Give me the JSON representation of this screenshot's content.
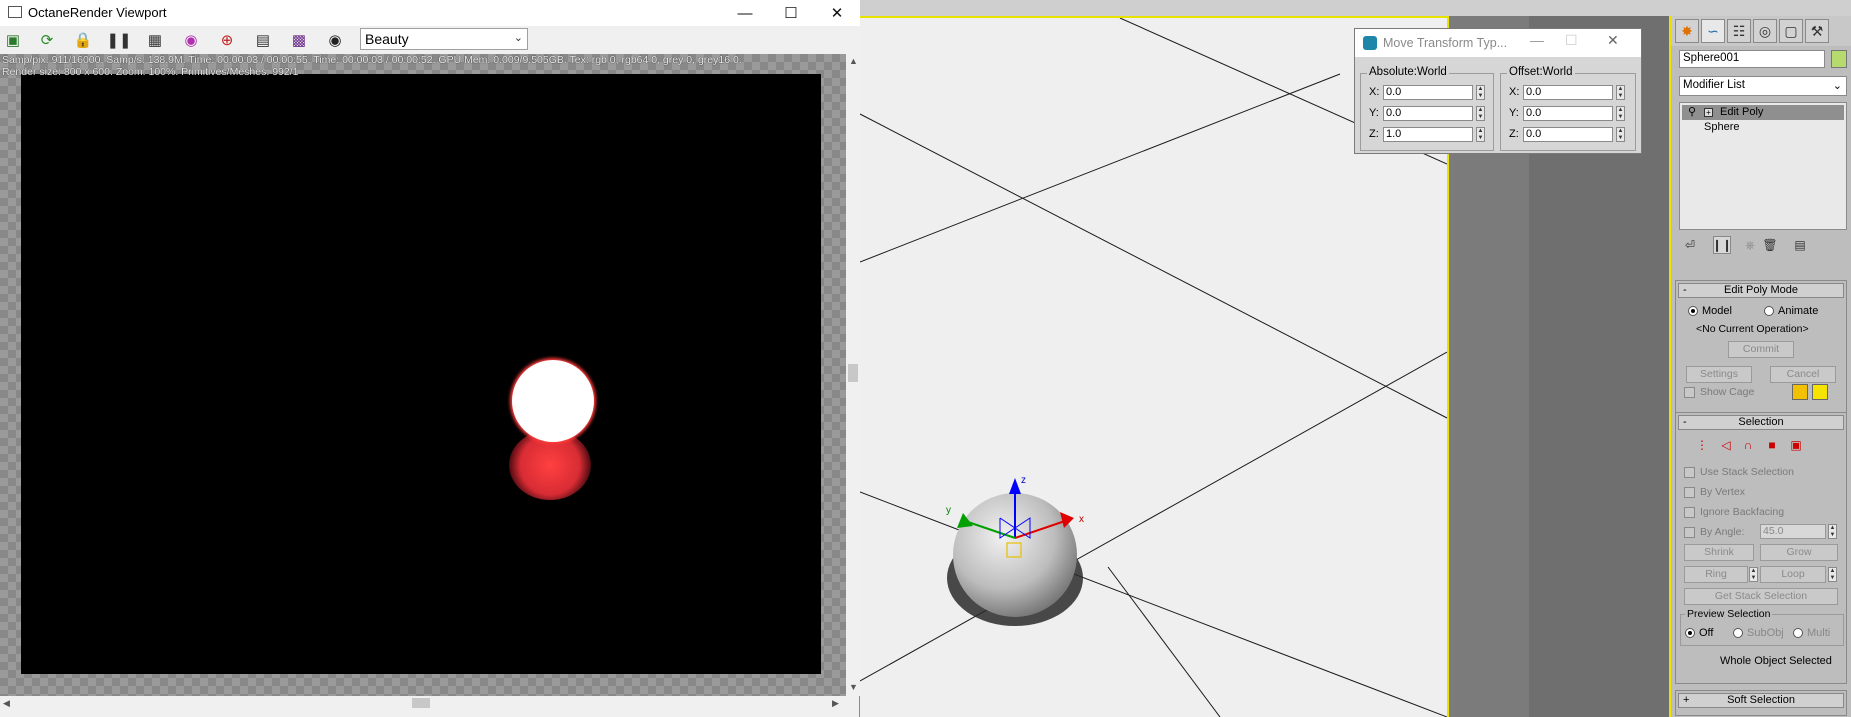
{
  "octane": {
    "title": "OctaneRender Viewport",
    "render_pass": "Beauty",
    "stats_line1": "Samp/pix: 911/16000.   Samp/s: 138.9M.   Time: 00:00:03 / 00:00:55.   Time: 00:00:03 / 00:00:52.   GPU Mem: 0.009/9.505GB.   Tex: rgb 0, rgb64 0, grey 0, grey16 0.",
    "stats_line2": "Render size: 800 x 600.   Zoom: 100%.   Primitives/Meshes: 992/1",
    "toolbar_icons": [
      "save-render-icon",
      "restart-render-icon",
      "lock-icon",
      "pause-icon",
      "region-render-icon",
      "color-picker-icon",
      "focus-picker-icon",
      "settings-icon",
      "film-icon",
      "camera-icon"
    ]
  },
  "move_transform": {
    "title": "Move Transform Typ...",
    "absolute": {
      "label": "Absolute:World",
      "x_label": "X:",
      "y_label": "Y:",
      "z_label": "Z:",
      "x": "0.0",
      "y": "0.0",
      "z": "1.0"
    },
    "offset": {
      "label": "Offset:World",
      "x_label": "X:",
      "y_label": "Y:",
      "z_label": "Z:",
      "x": "0.0",
      "y": "0.0",
      "z": "0.0"
    }
  },
  "viewport": {
    "gizmo": {
      "x_label": "x",
      "y_label": "y",
      "z_label": "z"
    }
  },
  "command_panel": {
    "object_name": "Sphere001",
    "object_color": "#b7da6e",
    "modifier_list": "Modifier List",
    "stack": [
      "Edit Poly",
      "Sphere"
    ],
    "edit_poly_mode": {
      "header": "Edit Poly Mode",
      "model": "Model",
      "animate": "Animate",
      "operation": "<No Current Operation>",
      "commit": "Commit",
      "settings": "Settings",
      "cancel": "Cancel",
      "show_cage": "Show Cage"
    },
    "selection": {
      "header": "Selection",
      "use_stack": "Use Stack Selection",
      "by_vertex": "By Vertex",
      "ignore_backfacing": "Ignore Backfacing",
      "by_angle": "By Angle:",
      "angle_value": "45.0",
      "shrink": "Shrink",
      "grow": "Grow",
      "ring": "Ring",
      "loop": "Loop",
      "get_stack": "Get Stack Selection",
      "preview_label": "Preview Selection",
      "off": "Off",
      "subobj": "SubObj",
      "multi": "Multi",
      "status": "Whole Object Selected"
    },
    "soft_selection": {
      "header": "Soft Selection"
    }
  },
  "colors": {
    "accent_yellow": "#e8e200",
    "render_red": "#ff3b3b",
    "cage_color_1": "#f2c200",
    "cage_color_2": "#f7e300"
  }
}
